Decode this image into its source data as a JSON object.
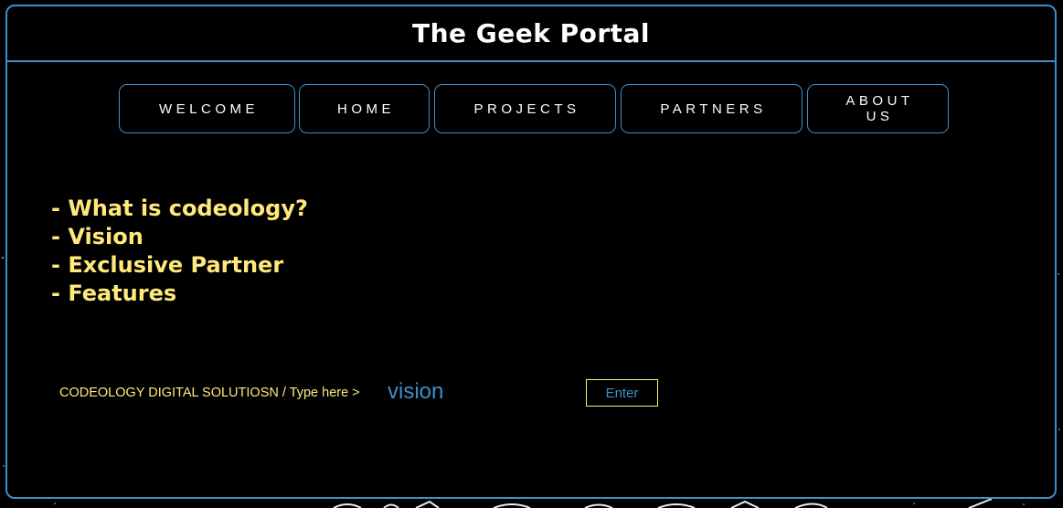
{
  "app": {
    "title": "The Geek Portal"
  },
  "nav": {
    "items": [
      {
        "label": "WELCOME"
      },
      {
        "label": "HOME"
      },
      {
        "label": "PROJECTS"
      },
      {
        "label": "PARTNERS"
      },
      {
        "label": "ABOUT US"
      }
    ]
  },
  "topics": [
    "- What is codeology?",
    "- Vision",
    "- Exclusive Partner",
    "- Features"
  ],
  "prompt": {
    "label": "CODEOLOGY DIGITAL SOLUTIOSN / Type here >",
    "value": "vision",
    "enter_label": "Enter"
  },
  "colors": {
    "accent_blue": "#3d8fc9",
    "highlight_yellow": "#ffe97a",
    "background": "#000000",
    "title_text": "#ffffff"
  }
}
